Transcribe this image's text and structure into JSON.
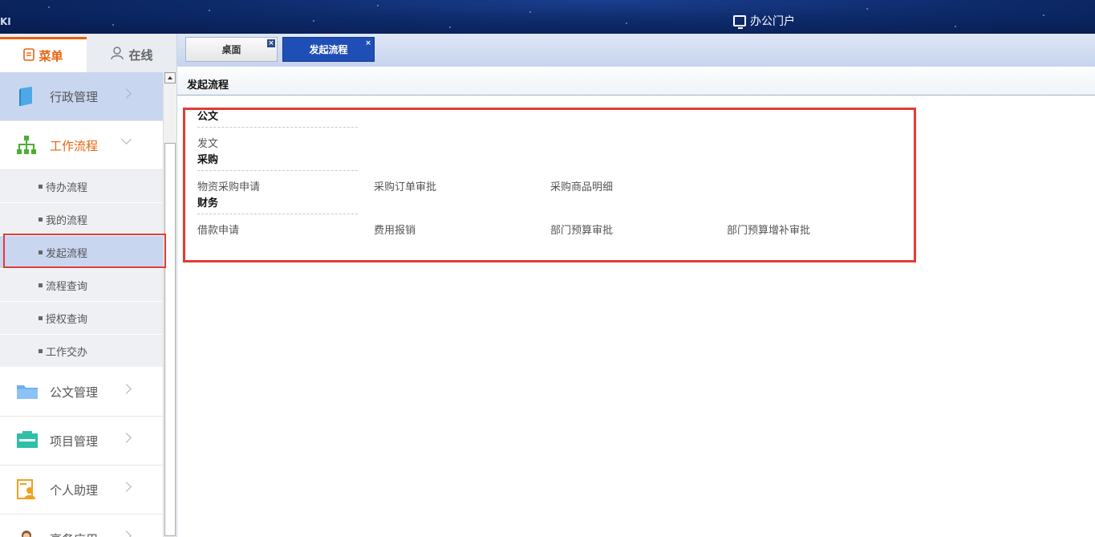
{
  "header": {
    "brand_fragment": "KI",
    "portal_label": "办公门户"
  },
  "left_tabs": {
    "menu": "菜单",
    "online": "在线"
  },
  "menu": {
    "items": [
      {
        "label": "行政管理",
        "icon": "book-icon"
      },
      {
        "label": "工作流程",
        "icon": "org-chart-icon"
      },
      {
        "label": "公文管理",
        "icon": "folder-icon"
      },
      {
        "label": "项目管理",
        "icon": "cabinet-icon"
      },
      {
        "label": "个人助理",
        "icon": "person-card-icon"
      },
      {
        "label": "高务应用",
        "icon": "user-avatar-icon"
      }
    ],
    "sub_items": [
      "待办流程",
      "我的流程",
      "发起流程",
      "流程查询",
      "授权查询",
      "工作交办"
    ]
  },
  "window_tabs": [
    {
      "label": "桌面",
      "close": "×"
    },
    {
      "label": "发起流程",
      "close": "×"
    }
  ],
  "page_title": "发起流程",
  "categories": [
    {
      "title": "公文",
      "flows": [
        "发文"
      ]
    },
    {
      "title": "采购",
      "flows": [
        "物资采购申请",
        "采购订单审批",
        "采购商品明细"
      ]
    },
    {
      "title": "财务",
      "flows": [
        "借款申请",
        "费用报销",
        "部门预算审批",
        "部门预算增补审批"
      ]
    }
  ],
  "colors": {
    "accent_orange": "#e8630e",
    "tab_active_blue": "#1f4fb6",
    "highlight_red": "#e53935",
    "selected_bg": "#c9d6ef"
  }
}
